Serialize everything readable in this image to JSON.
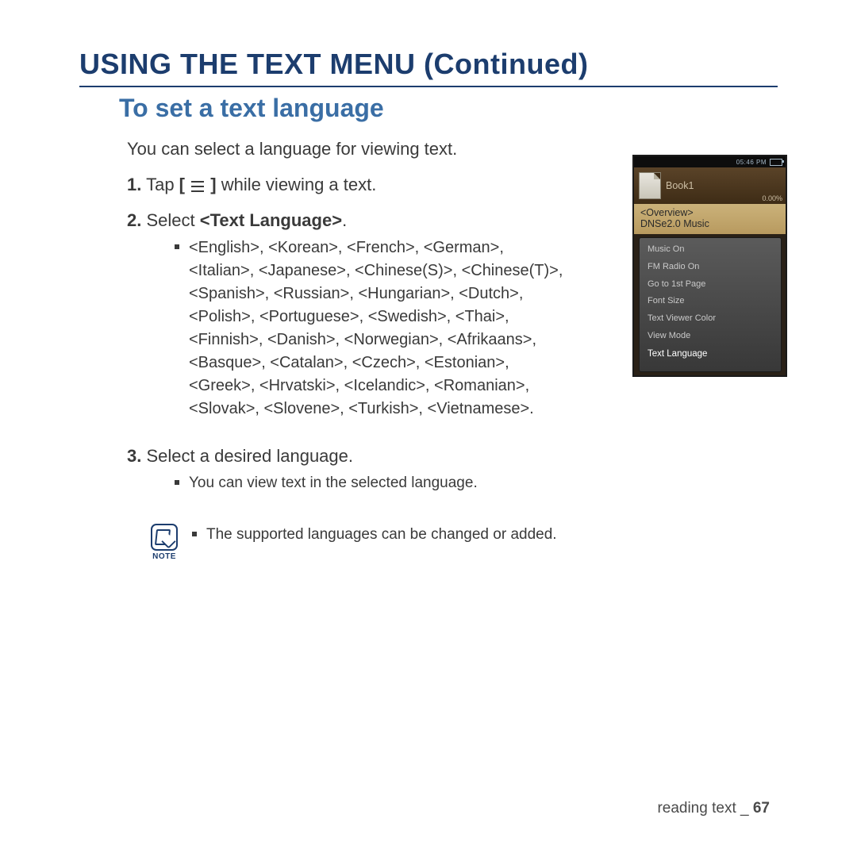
{
  "title": "USING THE TEXT MENU (Continued)",
  "subtitle": "To set a text language",
  "intro": "You can select a language for viewing text.",
  "step1": {
    "num": "1.",
    "pre": "Tap ",
    "bracket_open": "[ ",
    "bracket_close": " ]",
    "post": " while viewing a text."
  },
  "step2": {
    "num": "2.",
    "pre": "Select ",
    "bold": "<Text Language>",
    "post": ".",
    "langs": "<English>, <Korean>, <French>, <German>, <Italian>, <Japanese>, <Chinese(S)>, <Chinese(T)>, <Spanish>, <Russian>, <Hungarian>, <Dutch>, <Polish>, <Portuguese>, <Swedish>, <Thai>, <Finnish>, <Danish>, <Norwegian>, <Afrikaans>, <Basque>, <Catalan>, <Czech>, <Estonian>, <Greek>, <Hrvatski>, <Icelandic>, <Romanian>, <Slovak>, <Slovene>, <Turkish>, <Vietnamese>."
  },
  "step3": {
    "num": "3.",
    "text": "Select a desired language.",
    "bullet": "You can view text in the selected language."
  },
  "note": {
    "label": "NOTE",
    "text": "The supported languages can be changed or added."
  },
  "footer": {
    "section": "reading text _",
    "page": "67"
  },
  "device": {
    "time": "05:46 PM",
    "book": "Book1",
    "percent": "0.00%",
    "overview": "<Overview>",
    "subtitle": "DNSe2.0 Music",
    "menu": {
      "items": [
        "Music On",
        "FM Radio On",
        "Go to 1st Page",
        "Font Size",
        "Text Viewer Color",
        "View Mode",
        "Text Language"
      ],
      "selected_index": 6
    }
  }
}
